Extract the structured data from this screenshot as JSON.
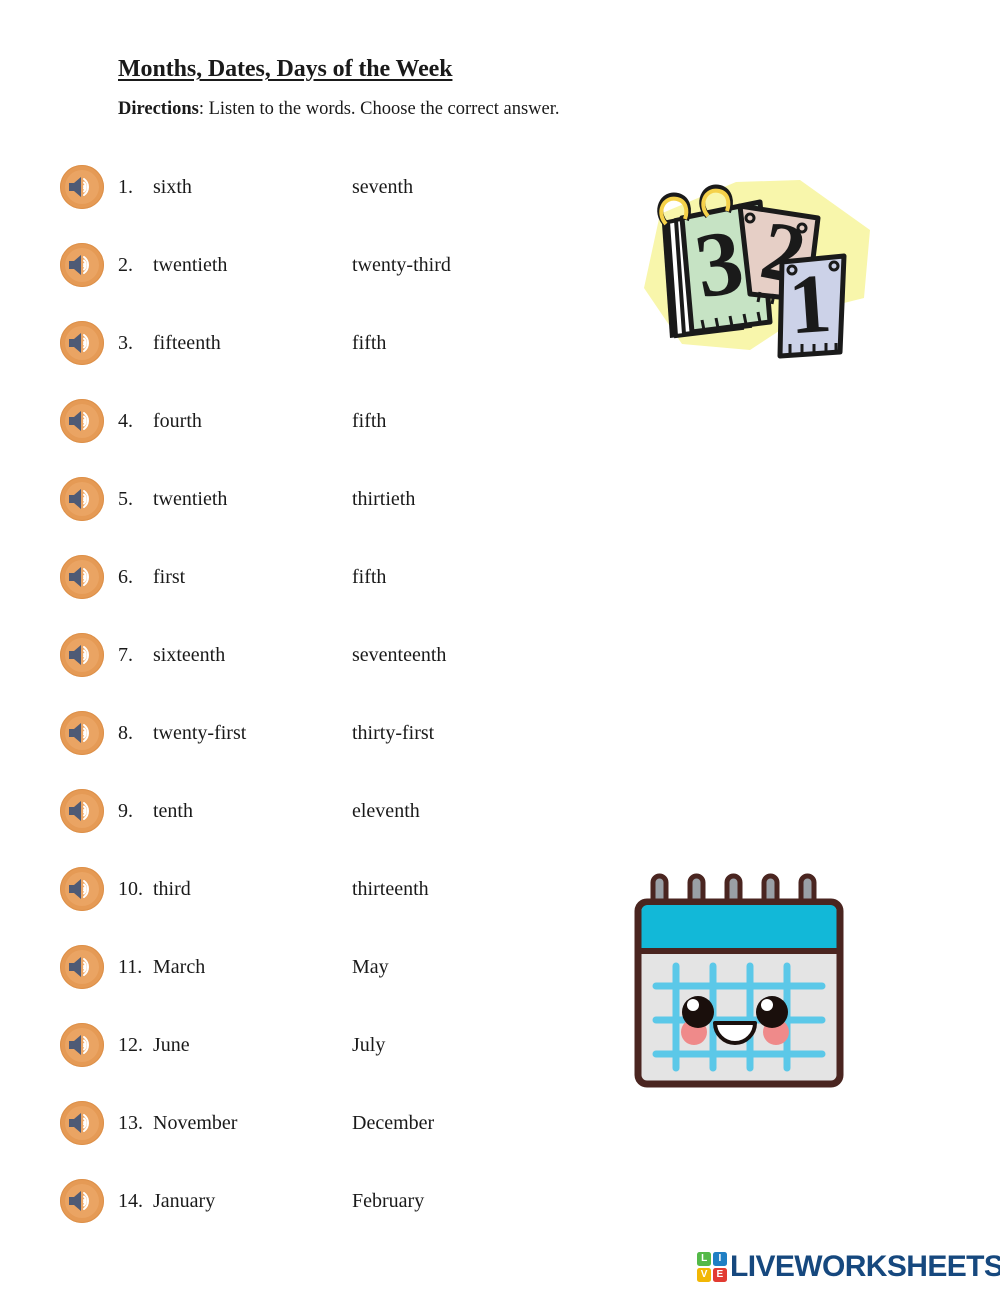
{
  "header": {
    "title": "Months, Dates, Days of the Week",
    "directions_label": "Directions",
    "directions_text": ": Listen to the words. Choose the correct answer."
  },
  "questions": [
    {
      "number": "1.",
      "option_a": "sixth",
      "option_b": "seventh"
    },
    {
      "number": "2.",
      "option_a": "twentieth",
      "option_b": "twenty-third"
    },
    {
      "number": "3.",
      "option_a": "fifteenth",
      "option_b": "fifth"
    },
    {
      "number": "4.",
      "option_a": "fourth",
      "option_b": "fifth"
    },
    {
      "number": "5.",
      "option_a": "twentieth",
      "option_b": "thirtieth"
    },
    {
      "number": "6.",
      "option_a": "first",
      "option_b": "fifth"
    },
    {
      "number": "7.",
      "option_a": "sixteenth",
      "option_b": "seventeenth"
    },
    {
      "number": "8.",
      "option_a": "twenty-first",
      "option_b": "thirty-first"
    },
    {
      "number": "9.",
      "option_a": "tenth",
      "option_b": "eleventh"
    },
    {
      "number": "10.",
      "option_a": "third",
      "option_b": "thirteenth"
    },
    {
      "number": "11.",
      "option_a": "March",
      "option_b": "May"
    },
    {
      "number": "12.",
      "option_a": "June",
      "option_b": "July"
    },
    {
      "number": "13.",
      "option_a": "November",
      "option_b": "December"
    },
    {
      "number": "14.",
      "option_a": "January",
      "option_b": "February"
    }
  ],
  "illustrations": {
    "calendar_pages": {
      "name": "torn-calendar-pages",
      "page_numbers": [
        "3",
        "2",
        "1"
      ],
      "colors": {
        "backdrop": "#f7f5a8",
        "page_three": "#c6e3c4",
        "page_two": "#e6cfc6",
        "page_one": "#ccd2e8",
        "rings": "#f5d14a",
        "outline": "#1a1a1a"
      }
    },
    "kawaii_calendar": {
      "name": "smiling-calendar",
      "colors": {
        "outline": "#4a2520",
        "header": "#12b8d8",
        "body": "#e4e4e4",
        "grid": "#5bc8e8",
        "rings": "#9aa0a6",
        "blush": "#ef8a8a",
        "eyes": "#1a0f0c",
        "mouth": "#ffffff"
      }
    }
  },
  "footer": {
    "logo_tiles": [
      "L",
      "I",
      "V",
      "E"
    ],
    "wordmark": "LIVEWORKSHEETS"
  }
}
